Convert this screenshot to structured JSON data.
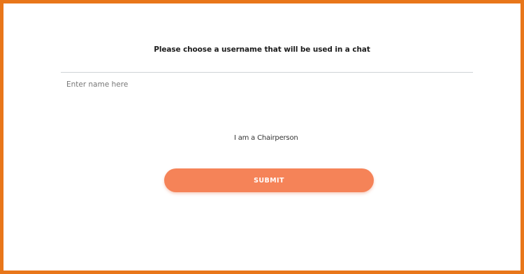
{
  "form": {
    "heading": "Please choose a username that will be used in a chat",
    "name_placeholder": "Enter name here",
    "name_value": "",
    "role_label": "I am a Chairperson",
    "submit_label": "SUBMIT"
  },
  "colors": {
    "frame_border": "#e8761a",
    "submit_background": "#f58358",
    "submit_text": "#ffffff"
  }
}
